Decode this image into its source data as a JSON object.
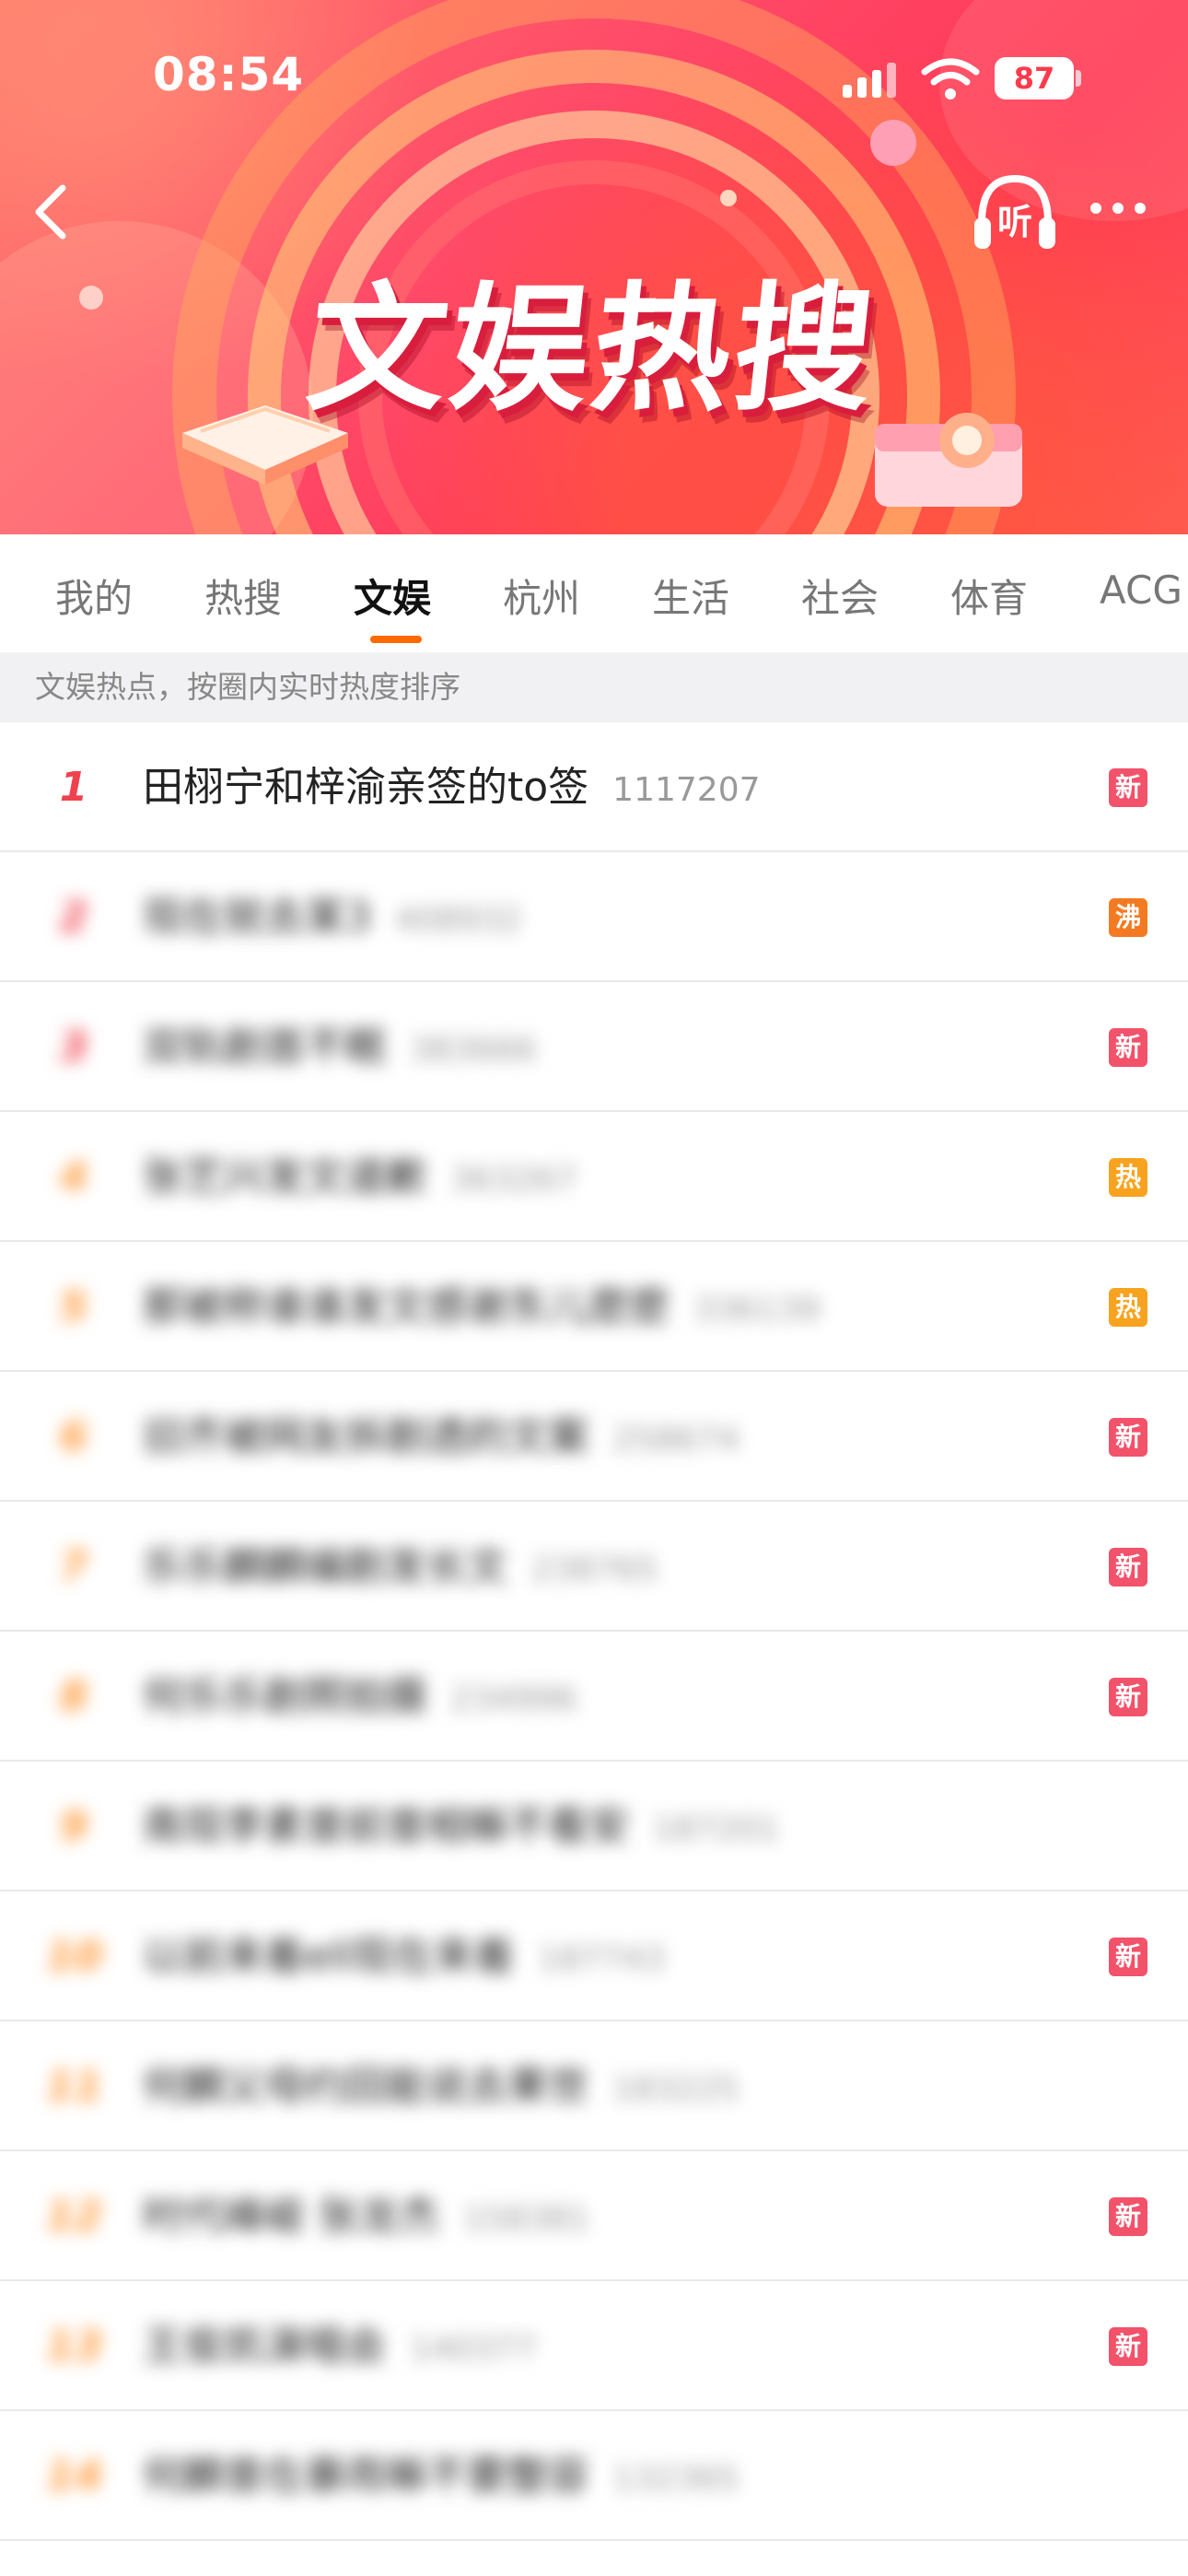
{
  "status_bar": {
    "time": "08:54",
    "battery": "87"
  },
  "header": {
    "banner_title": "文娱热搜",
    "listen_label": "听"
  },
  "tabs": [
    {
      "label": "我的"
    },
    {
      "label": "热搜"
    },
    {
      "label": "文娱",
      "active": true
    },
    {
      "label": "杭州"
    },
    {
      "label": "生活"
    },
    {
      "label": "社会"
    },
    {
      "label": "体育"
    },
    {
      "label": "ACG"
    }
  ],
  "subheader": "文娱热点，按圈内实时热度排序",
  "list": [
    {
      "rank": "1",
      "title": "田栩宁和梓渝亲签的to签",
      "count": "1117207",
      "badge": "新",
      "badge_color": "#f2526a"
    },
    {
      "rank": "2",
      "title": "现在就去某3",
      "count": "408932",
      "badge": "沸",
      "badge_color": "#f47a21"
    },
    {
      "rank": "3",
      "title": "双轨剧首不眠",
      "count": "383666",
      "badge": "新",
      "badge_color": "#f2526a"
    },
    {
      "rank": "4",
      "title": "张艺兴发文道歉",
      "count": "363267",
      "badge": "热",
      "badge_color": "#f7a31f"
    },
    {
      "rank": "5",
      "title": "那被称谁谁发文感谢东儿麽麽",
      "count": "336139",
      "badge": "热",
      "badge_color": "#f7a31f"
    },
    {
      "rank": "6",
      "title": "旧齐被网友拆剧透的文案",
      "count": "258674",
      "badge": "新",
      "badge_color": "#f2526a"
    },
    {
      "rank": "7",
      "title": "乐乐麟麟编剧发长文",
      "count": "238765",
      "badge": "新",
      "badge_color": "#f2526a"
    },
    {
      "rank": "8",
      "title": "何乐乐剧照拍摄",
      "count": "234996",
      "badge": "新",
      "badge_color": "#f2526a"
    },
    {
      "rank": "9",
      "title": "南现李素曾前曾相嘛不看安",
      "count": "187201",
      "badge": "",
      "badge_color": ""
    },
    {
      "rank": "10",
      "title": "以前来着ell现在来着",
      "count": "187743",
      "badge": "新",
      "badge_color": "#f2526a"
    },
    {
      "rank": "11",
      "title": "何麟父母约回能说去果世",
      "count": "183225",
      "badge": "",
      "badge_color": ""
    },
    {
      "rank": "12",
      "title": "时代峰峻 张龙杰",
      "count": "158381",
      "badge": "新",
      "badge_color": "#f2526a"
    },
    {
      "rank": "13",
      "title": "王俊凯演唱会",
      "count": "140377",
      "badge": "新",
      "badge_color": "#f2526a"
    },
    {
      "rank": "14",
      "title": "何麟曾在暴雨嘛不要整容",
      "count": "132365",
      "badge": "",
      "badge_color": ""
    }
  ]
}
